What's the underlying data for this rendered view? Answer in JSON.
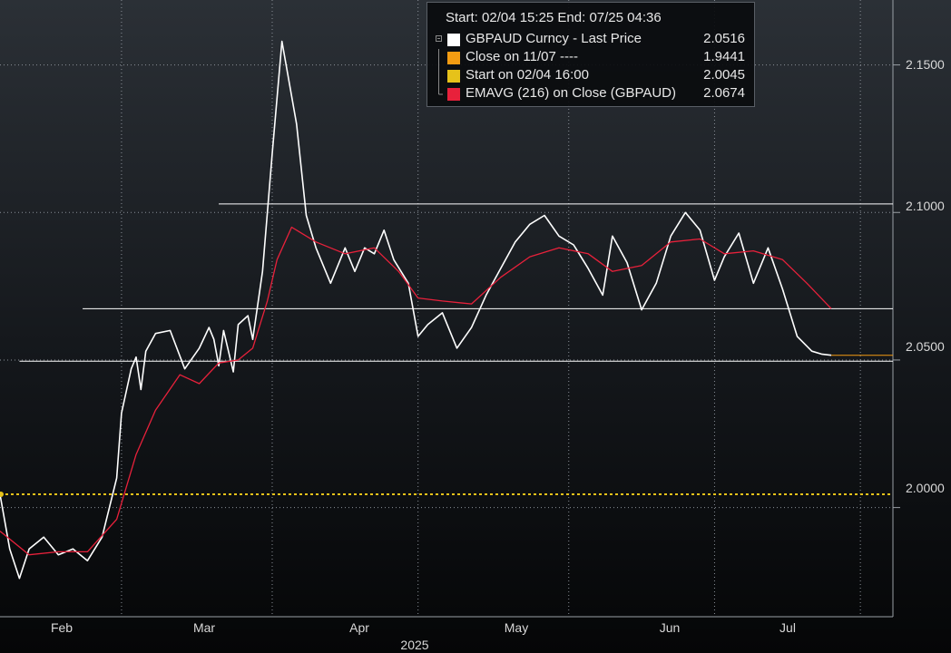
{
  "chart_data": {
    "type": "line",
    "legend": {
      "placement": "top-center",
      "header": "Start: 02/04 15:25 End: 07/25 04:36",
      "entries": [
        {
          "label": "GBPAUD Curncy - Last Price",
          "value": "2.0516",
          "color": "#ffffff"
        },
        {
          "label": "Close on 11/07 ----",
          "value": "1.9441",
          "color": "#f39c12"
        },
        {
          "label": "Start on 02/04 16:00",
          "value": "2.0045",
          "color": "#e6c21a"
        },
        {
          "label": "EMAVG (216)  on Close (GBPAUD)",
          "value": "2.0674",
          "color": "#e8213b"
        }
      ]
    },
    "x_ticks": [
      "Feb",
      "Mar",
      "Apr",
      "May",
      "Jun",
      "Jul"
    ],
    "x_year_label": "2025",
    "x_range": [
      "2025-02-04",
      "2025-07-25"
    ],
    "y_ticks": [
      "2.1500",
      "2.1000",
      "2.0500",
      "2.0000"
    ],
    "ylim": [
      1.963,
      2.172
    ],
    "grid": true,
    "horizontal_levels": [
      {
        "from": "2025-03-21",
        "to": "2025-07-31",
        "value": 2.1029,
        "color": "#ffffff"
      },
      {
        "from": "2025-02-21",
        "to": "2025-07-31",
        "value": 2.0674,
        "color": "#ffffff"
      },
      {
        "from": "2025-02-08",
        "to": "2025-07-31",
        "value": 2.0496,
        "color": "#ffffff"
      },
      {
        "from": "2025-02-04",
        "to": "2025-07-31",
        "value": 2.0045,
        "color": "#e6c21a",
        "dashed": true
      }
    ],
    "series": [
      {
        "name": "GBPAUD Curncy - Last Price",
        "color": "#ffffff",
        "x": [
          "2025-02-04",
          "2025-02-06",
          "2025-02-08",
          "2025-02-10",
          "2025-02-13",
          "2025-02-16",
          "2025-02-19",
          "2025-02-22",
          "2025-02-25",
          "2025-02-28",
          "2025-03-01",
          "2025-03-03",
          "2025-03-04",
          "2025-03-05",
          "2025-03-06",
          "2025-03-08",
          "2025-03-11",
          "2025-03-14",
          "2025-03-17",
          "2025-03-19",
          "2025-03-20",
          "2025-03-21",
          "2025-03-22",
          "2025-03-24",
          "2025-03-25",
          "2025-03-27",
          "2025-03-28",
          "2025-03-30",
          "2025-04-01",
          "2025-04-03",
          "2025-04-06",
          "2025-04-08",
          "2025-04-10",
          "2025-04-13",
          "2025-04-16",
          "2025-04-18",
          "2025-04-20",
          "2025-04-22",
          "2025-04-24",
          "2025-04-26",
          "2025-04-29",
          "2025-05-01",
          "2025-05-03",
          "2025-05-06",
          "2025-05-09",
          "2025-05-12",
          "2025-05-15",
          "2025-05-18",
          "2025-05-21",
          "2025-05-24",
          "2025-05-27",
          "2025-05-30",
          "2025-06-02",
          "2025-06-05",
          "2025-06-08",
          "2025-06-10",
          "2025-06-13",
          "2025-06-16",
          "2025-06-19",
          "2025-06-22",
          "2025-06-25",
          "2025-06-28",
          "2025-07-01",
          "2025-07-03",
          "2025-07-06",
          "2025-07-09",
          "2025-07-12",
          "2025-07-15",
          "2025-07-18",
          "2025-07-21",
          "2025-07-23",
          "2025-07-25"
        ],
        "y": [
          2.0045,
          1.986,
          1.976,
          1.986,
          1.99,
          1.984,
          1.986,
          1.982,
          1.99,
          2.01,
          2.032,
          2.047,
          2.051,
          2.04,
          2.053,
          2.059,
          2.06,
          2.047,
          2.054,
          2.061,
          2.057,
          2.048,
          2.06,
          2.046,
          2.062,
          2.065,
          2.057,
          2.08,
          2.12,
          2.158,
          2.13,
          2.099,
          2.088,
          2.076,
          2.088,
          2.08,
          2.088,
          2.086,
          2.094,
          2.084,
          2.076,
          2.058,
          2.062,
          2.066,
          2.054,
          2.061,
          2.072,
          2.081,
          2.09,
          2.096,
          2.099,
          2.092,
          2.089,
          2.081,
          2.072,
          2.092,
          2.083,
          2.067,
          2.076,
          2.092,
          2.1,
          2.094,
          2.077,
          2.085,
          2.093,
          2.076,
          2.088,
          2.074,
          2.058,
          2.053,
          2.052,
          2.0516
        ]
      },
      {
        "name": "EMAVG (216)  on Close (GBPAUD)",
        "color": "#e8213b",
        "x": [
          "2025-02-04",
          "2025-02-10",
          "2025-02-16",
          "2025-02-22",
          "2025-02-28",
          "2025-03-04",
          "2025-03-08",
          "2025-03-13",
          "2025-03-17",
          "2025-03-21",
          "2025-03-25",
          "2025-03-28",
          "2025-03-31",
          "2025-04-02",
          "2025-04-05",
          "2025-04-10",
          "2025-04-16",
          "2025-04-22",
          "2025-04-27",
          "2025-05-01",
          "2025-05-06",
          "2025-05-12",
          "2025-05-18",
          "2025-05-24",
          "2025-05-30",
          "2025-06-05",
          "2025-06-10",
          "2025-06-16",
          "2025-06-22",
          "2025-06-28",
          "2025-07-03",
          "2025-07-09",
          "2025-07-15",
          "2025-07-20",
          "2025-07-25"
        ],
        "y": [
          1.992,
          1.984,
          1.985,
          1.985,
          1.996,
          2.018,
          2.033,
          2.045,
          2.042,
          2.049,
          2.05,
          2.054,
          2.07,
          2.084,
          2.095,
          2.09,
          2.086,
          2.088,
          2.08,
          2.071,
          2.07,
          2.069,
          2.078,
          2.085,
          2.088,
          2.086,
          2.08,
          2.082,
          2.09,
          2.091,
          2.086,
          2.087,
          2.084,
          2.076,
          2.0674
        ]
      }
    ]
  }
}
